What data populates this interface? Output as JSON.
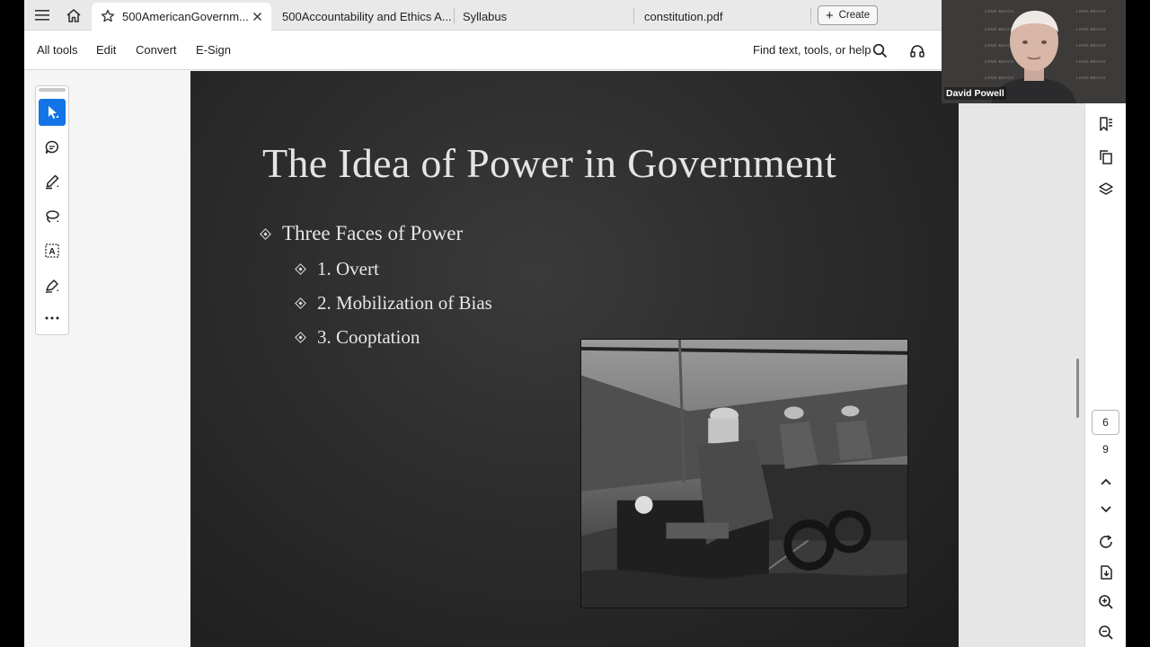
{
  "tabs": [
    {
      "label": "500AmericanGovernm...",
      "active": true
    },
    {
      "label": "500Accountability and Ethics A..."
    },
    {
      "label": "Syllabus"
    },
    {
      "label": "constitution.pdf"
    }
  ],
  "create_label": "Create",
  "toolbar": {
    "items": [
      "All tools",
      "Edit",
      "Convert",
      "E-Sign"
    ],
    "find_placeholder": "Find text, tools, or help"
  },
  "slide": {
    "title": "The Idea of Power in Government",
    "bullets": [
      {
        "text": "Three Faces of Power"
      },
      {
        "text": "1. Overt"
      },
      {
        "text": "2. Mobilization of Bias"
      },
      {
        "text": "3. Cooptation"
      }
    ]
  },
  "page_nav": {
    "current": "6",
    "total": "9"
  },
  "video": {
    "name": "David Powell",
    "watermark": "LONG BEACH"
  },
  "colors": {
    "accent": "#1473e6",
    "slide_bg": "#2c2c2c",
    "slide_text": "#e4e4e4"
  },
  "icons": {
    "menu": "hamburger-icon",
    "home": "home-icon",
    "star": "star-icon",
    "close": "close-icon",
    "search": "search-icon",
    "headset": "headphones-icon",
    "tools": [
      "select-cursor-icon",
      "comment-icon",
      "highlighter-icon",
      "lasso-icon",
      "text-select-icon",
      "sign-pen-icon",
      "more-icon"
    ],
    "rail": [
      "bookmark-icon",
      "copy-pages-icon",
      "layers-icon",
      "chevron-up-icon",
      "chevron-down-icon",
      "refresh-icon",
      "save-file-icon",
      "zoom-in-icon",
      "zoom-out-icon"
    ]
  }
}
